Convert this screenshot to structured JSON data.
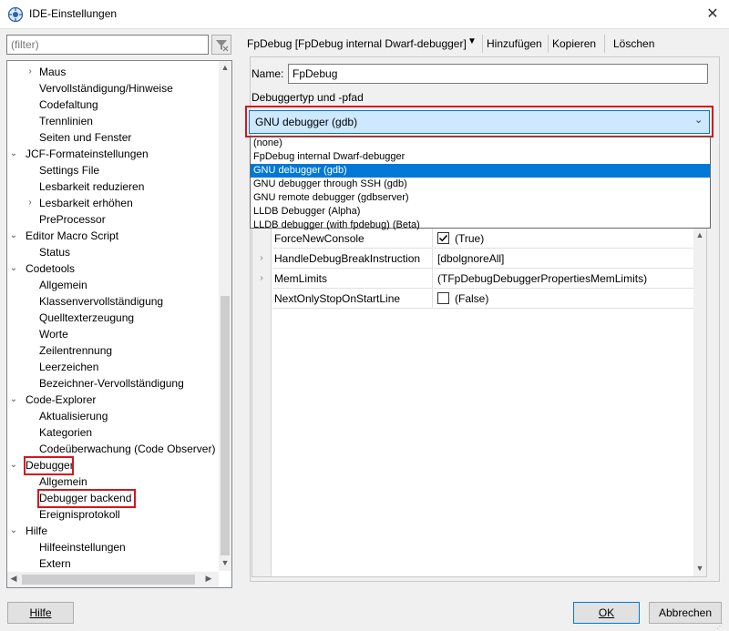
{
  "window": {
    "title": "IDE-Einstellungen",
    "close_glyph": "✕"
  },
  "filter": {
    "placeholder": "(filter)"
  },
  "tree": {
    "items": [
      {
        "label": "Maus",
        "level": 1,
        "arrow": "›"
      },
      {
        "label": "Vervollständigung/Hinweise",
        "level": 1,
        "arrow": ""
      },
      {
        "label": "Codefaltung",
        "level": 1,
        "arrow": ""
      },
      {
        "label": "Trennlinien",
        "level": 1,
        "arrow": ""
      },
      {
        "label": "Seiten und Fenster",
        "level": 1,
        "arrow": ""
      },
      {
        "label": "JCF-Formateinstellungen",
        "level": 0,
        "arrow": "⌄"
      },
      {
        "label": "Settings File",
        "level": 1,
        "arrow": ""
      },
      {
        "label": "Lesbarkeit reduzieren",
        "level": 1,
        "arrow": ""
      },
      {
        "label": "Lesbarkeit erhöhen",
        "level": 1,
        "arrow": "›"
      },
      {
        "label": "PreProcessor",
        "level": 1,
        "arrow": ""
      },
      {
        "label": "Editor Macro Script",
        "level": 0,
        "arrow": "⌄"
      },
      {
        "label": "Status",
        "level": 1,
        "arrow": ""
      },
      {
        "label": "Codetools",
        "level": 0,
        "arrow": "⌄"
      },
      {
        "label": "Allgemein",
        "level": 1,
        "arrow": ""
      },
      {
        "label": "Klassenvervollständigung",
        "level": 1,
        "arrow": ""
      },
      {
        "label": "Quelltexterzeugung",
        "level": 1,
        "arrow": ""
      },
      {
        "label": "Worte",
        "level": 1,
        "arrow": ""
      },
      {
        "label": "Zeilentrennung",
        "level": 1,
        "arrow": ""
      },
      {
        "label": "Leerzeichen",
        "level": 1,
        "arrow": ""
      },
      {
        "label": "Bezeichner-Vervollständigung",
        "level": 1,
        "arrow": ""
      },
      {
        "label": "Code-Explorer",
        "level": 0,
        "arrow": "⌄"
      },
      {
        "label": "Aktualisierung",
        "level": 1,
        "arrow": ""
      },
      {
        "label": "Kategorien",
        "level": 1,
        "arrow": ""
      },
      {
        "label": "Codeüberwachung (Code Observer)",
        "level": 1,
        "arrow": ""
      },
      {
        "label": "Debugger",
        "level": 0,
        "arrow": "⌄"
      },
      {
        "label": "Allgemein",
        "level": 1,
        "arrow": ""
      },
      {
        "label": "Debugger backend",
        "level": 1,
        "arrow": ""
      },
      {
        "label": "Ereignisprotokoll",
        "level": 1,
        "arrow": ""
      },
      {
        "label": "Hilfe",
        "level": 0,
        "arrow": "⌄"
      },
      {
        "label": "Hilfeeinstellungen",
        "level": 1,
        "arrow": ""
      },
      {
        "label": "Extern",
        "level": 1,
        "arrow": ""
      }
    ],
    "highlighted": [
      "Debugger",
      "Debugger backend"
    ]
  },
  "toolbar": {
    "profile": "FpDebug [FpDebug internal Dwarf-debugger]",
    "add": "Hinzufügen",
    "copy": "Kopieren",
    "delete": "Löschen"
  },
  "form": {
    "name_label": "Name:",
    "name_value": "FpDebug",
    "group_label": "Debuggertyp und -pfad",
    "combo_value": "GNU debugger (gdb)"
  },
  "dropdown": {
    "options": [
      "(none)",
      "FpDebug internal Dwarf-debugger",
      "GNU debugger (gdb)",
      "GNU debugger through SSH (gdb)",
      "GNU remote debugger (gdbserver)",
      "LLDB Debugger (Alpha)",
      "LLDB debugger (with fpdebug) (Beta)"
    ],
    "selected_index": 2
  },
  "properties": [
    {
      "name": "ForceNewConsole",
      "value": "(True)",
      "checkbox": true,
      "checked": true,
      "expandable": false
    },
    {
      "name": "HandleDebugBreakInstruction",
      "value": "[dbolgnoreAll]",
      "checkbox": false,
      "checked": false,
      "expandable": true
    },
    {
      "name": "MemLimits",
      "value": "(TFpDebugDebuggerPropertiesMemLimits)",
      "checkbox": false,
      "checked": false,
      "expandable": true
    },
    {
      "name": "NextOnlyStopOnStartLine",
      "value": "(False)",
      "checkbox": true,
      "checked": false,
      "expandable": false
    }
  ],
  "buttons": {
    "help": "Hilfe",
    "ok": "OK",
    "cancel": "Abbrechen"
  },
  "colors": {
    "highlight_red": "#d8141c",
    "selection_blue": "#0078d7",
    "combo_bg": "#cde8ff"
  }
}
